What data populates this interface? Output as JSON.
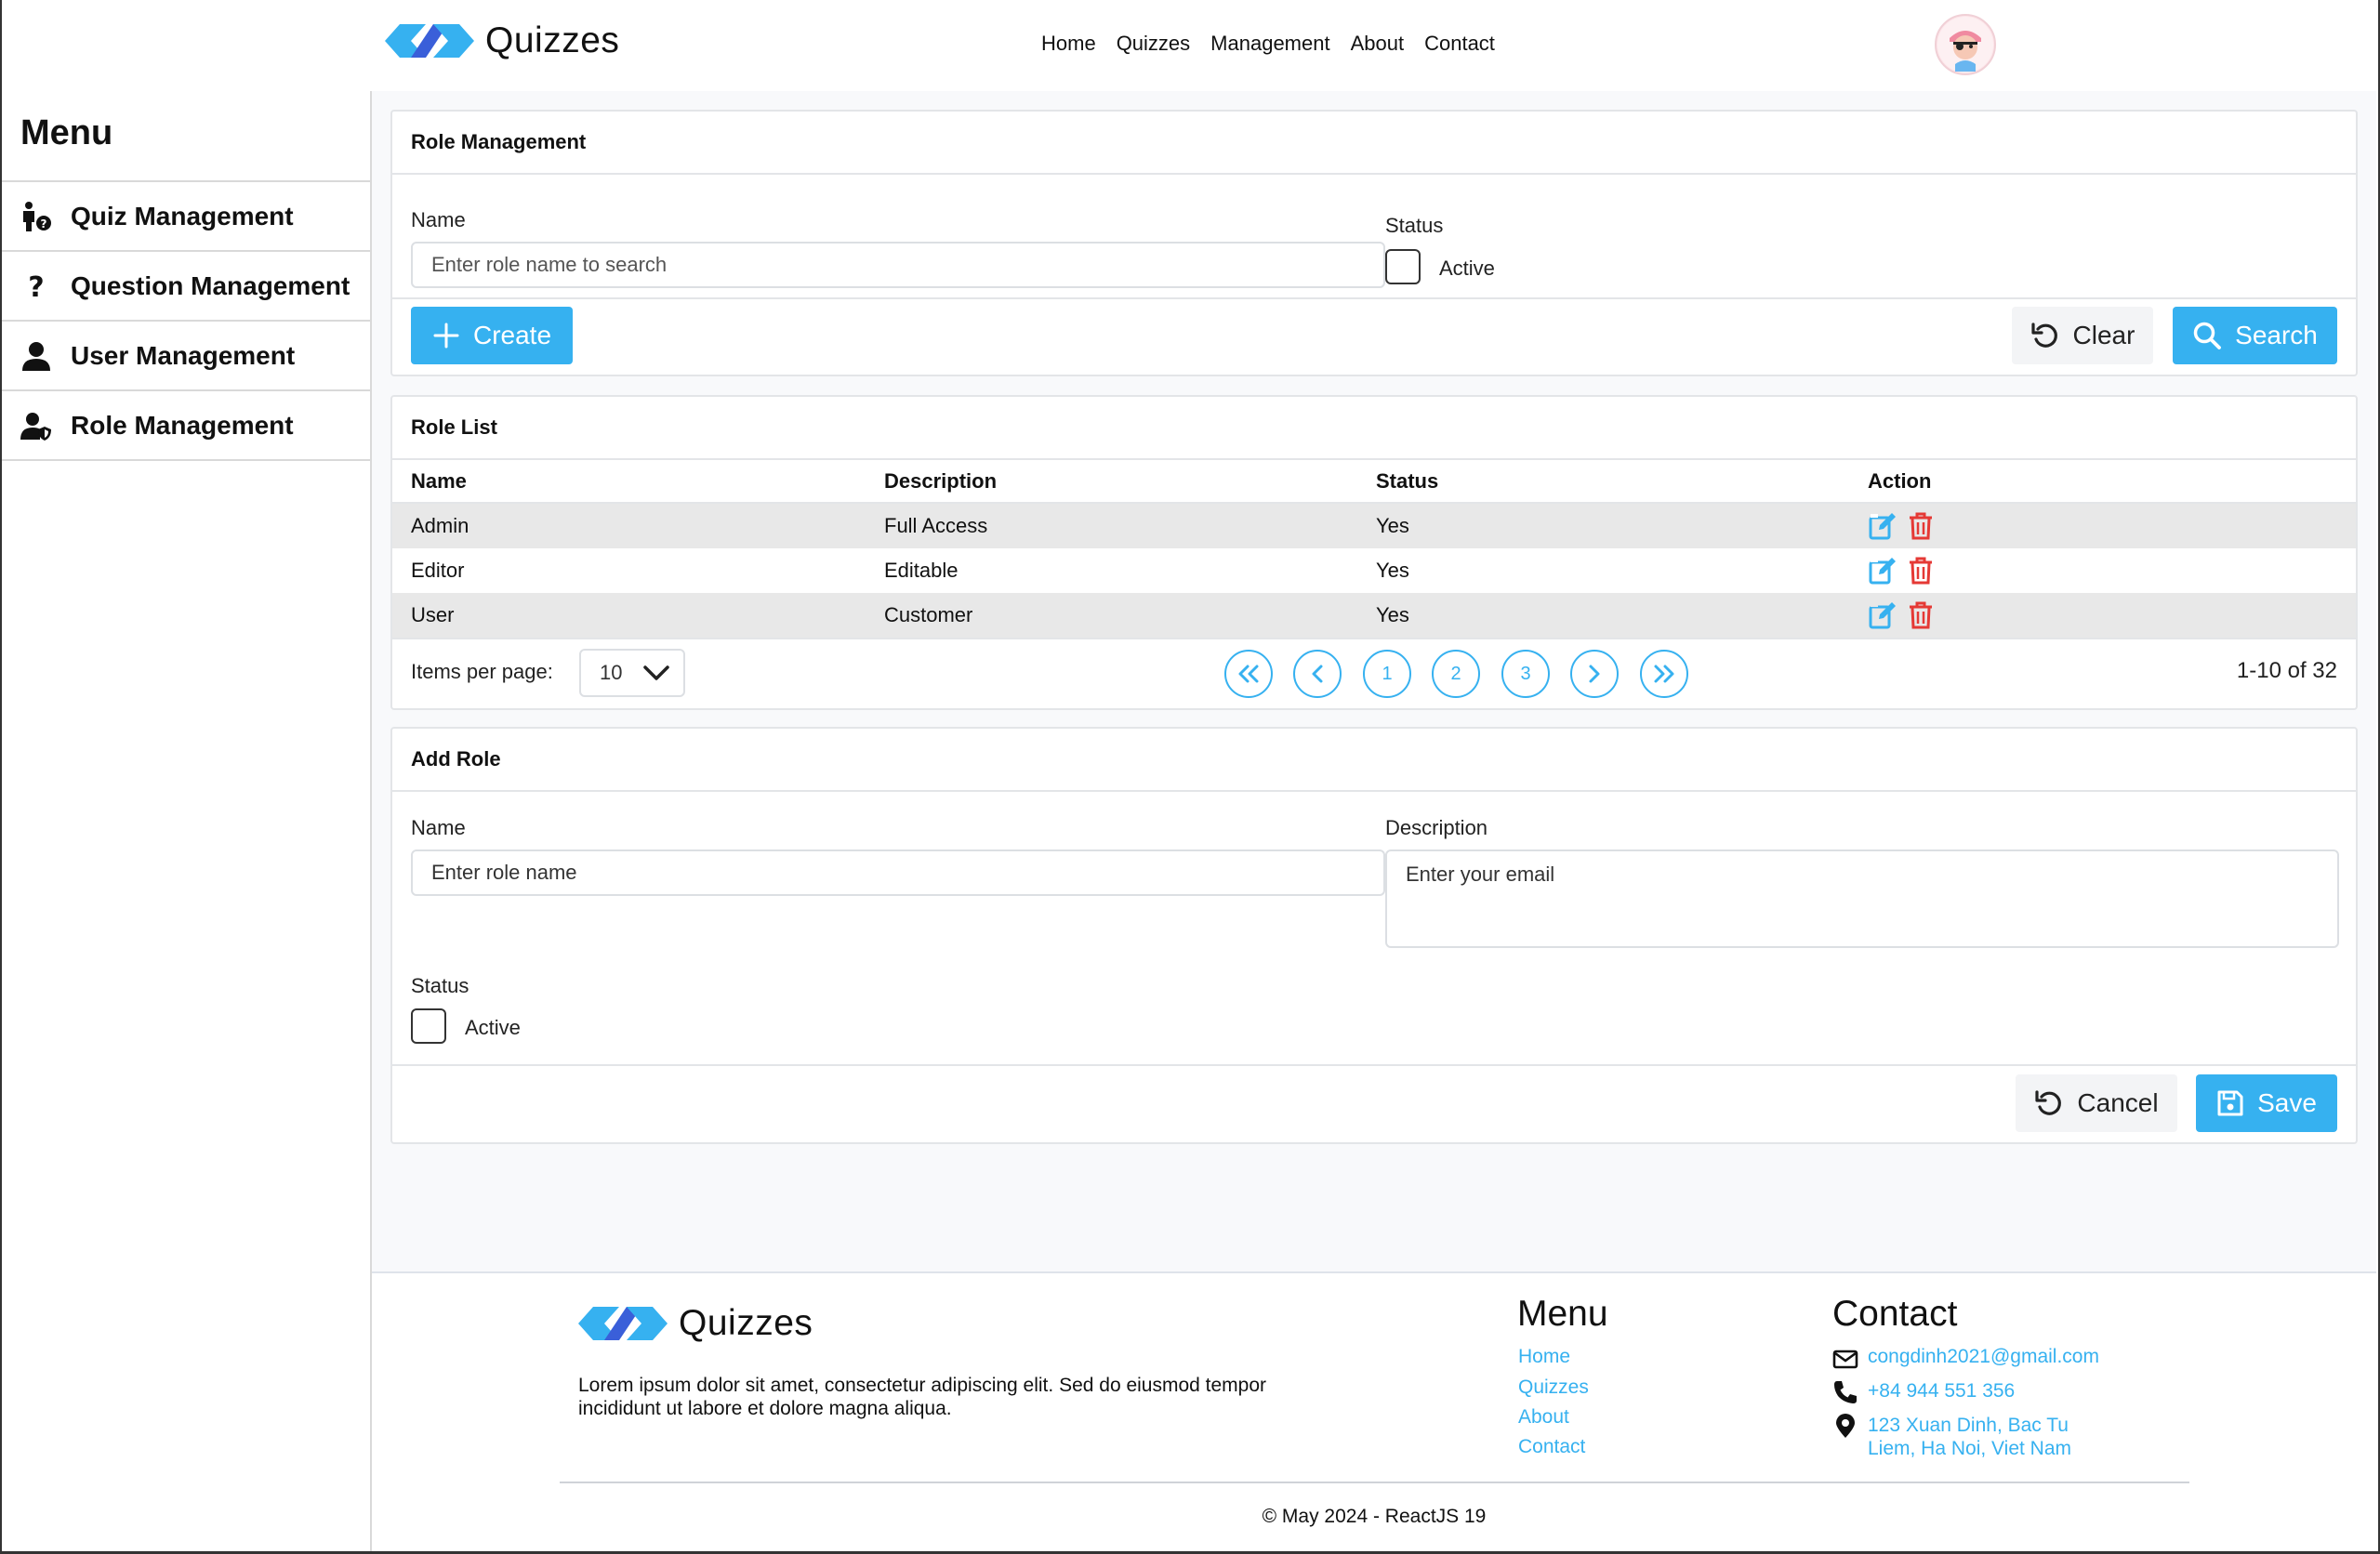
{
  "header": {
    "brand": "Quizzes",
    "nav": [
      "Home",
      "Quizzes",
      "Management",
      "About",
      "Contact"
    ]
  },
  "sidebar": {
    "title": "Menu",
    "items": [
      {
        "label": "Quiz Management",
        "icon": "person-question-icon"
      },
      {
        "label": "Question Management",
        "icon": "question-mark-icon"
      },
      {
        "label": "User Management",
        "icon": "user-icon"
      },
      {
        "label": "Role Management",
        "icon": "user-shield-icon"
      }
    ]
  },
  "search_card": {
    "title": "Role Management",
    "name_label": "Name",
    "name_placeholder": "Enter role name to search",
    "status_label": "Status",
    "active_label": "Active",
    "create_label": "Create",
    "clear_label": "Clear",
    "search_label": "Search"
  },
  "list_card": {
    "title": "Role List",
    "columns": [
      "Name",
      "Description",
      "Status",
      "Action"
    ],
    "rows": [
      {
        "name": "Admin",
        "description": "Full Access",
        "status": "Yes"
      },
      {
        "name": "Editor",
        "description": "Editable",
        "status": "Yes"
      },
      {
        "name": "User",
        "description": "Customer",
        "status": "Yes"
      }
    ],
    "items_per_page_label": "Items per page:",
    "items_per_page_value": "10",
    "pages": [
      "1",
      "2",
      "3"
    ],
    "range_text": "1-10 of 32"
  },
  "add_card": {
    "title": "Add Role",
    "name_label": "Name",
    "name_placeholder": "Enter role name",
    "description_label": "Description",
    "description_placeholder": "Enter your email",
    "status_label": "Status",
    "active_label": "Active",
    "cancel_label": "Cancel",
    "save_label": "Save"
  },
  "footer": {
    "brand": "Quizzes",
    "description": "Lorem ipsum dolor sit amet, consectetur adipiscing elit. Sed do eiusmod tempor incididunt ut labore et dolore magna aliqua.",
    "menu_title": "Menu",
    "menu_links": [
      "Home",
      "Quizzes",
      "About",
      "Contact"
    ],
    "contact_title": "Contact",
    "email": "congdinh2021@gmail.com",
    "phone": "+84 944 551 356",
    "address_line1": "123 Xuan Dinh, Bac Tu",
    "address_line2": "Liem, Ha Noi, Viet Nam",
    "copyright": "© May 2024 - ReactJS 19"
  },
  "colors": {
    "accent": "#36b1f0",
    "danger": "#e53935",
    "row_alt": "#e8e8e8"
  }
}
